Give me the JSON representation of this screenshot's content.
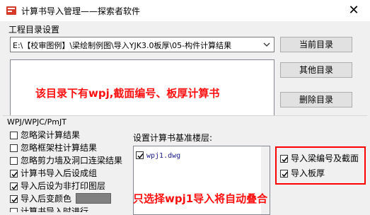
{
  "window": {
    "title": "计算书导入管理——探索者软件",
    "close_icon": "close-icon"
  },
  "project_dir": {
    "group_label": "工程目录设置",
    "path_value": "E:\\【校审图例】\\梁绘制例图\\导入YJK3.0板厚\\05-构件计算结果",
    "buttons": {
      "current": "当前目录",
      "other": "其他目录",
      "delete": "删除目录"
    },
    "annotation": "该目录下有wpj,截面编号、板厚计算书"
  },
  "wpj": {
    "group_label": "WPJ/WPJC/PmJT",
    "options": [
      {
        "label": "忽略梁计算结果",
        "checked": false
      },
      {
        "label": "忽略框架柱计算结果",
        "checked": false
      },
      {
        "label": "忽略剪力墙及洞口连梁结果",
        "checked": false
      },
      {
        "label": "计算书导入后设成组",
        "checked": true
      },
      {
        "label": "导入后设为非打印图层",
        "checked": true
      },
      {
        "label": "导入后变颜色",
        "checked": true
      },
      {
        "label": "计算书导入时进行...",
        "checked": false
      }
    ],
    "base_floor_label": "设置计算书基准楼层:",
    "files": [
      {
        "name": "wpj1.dwg",
        "checked": true
      }
    ],
    "import_options": [
      {
        "label": "导入梁编号及截面",
        "checked": true
      },
      {
        "label": "导入板厚",
        "checked": true
      }
    ],
    "annotation": "只选择wpj1导入将自动叠合"
  },
  "colors": {
    "annotation_red": "#ff1010",
    "highlight_box": "#ff0000",
    "swatch_gray": "#808080"
  }
}
